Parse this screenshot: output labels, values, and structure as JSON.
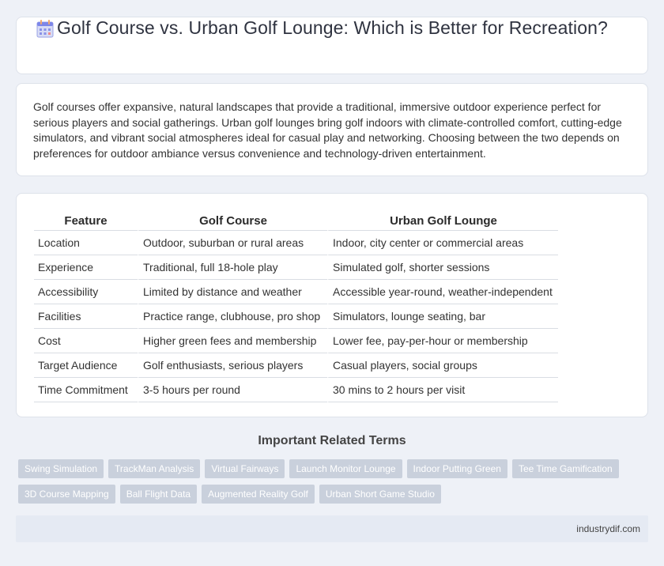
{
  "header": {
    "title": "Golf Course vs. Urban Golf Lounge: Which is Better for Recreation?",
    "icon": "calendar-icon"
  },
  "intro": {
    "text": "Golf courses offer expansive, natural landscapes that provide a traditional, immersive outdoor experience perfect for serious players and social gatherings. Urban golf lounges bring golf indoors with climate-controlled comfort, cutting-edge simulators, and vibrant social atmospheres ideal for casual play and networking. Choosing between the two depends on preferences for outdoor ambiance versus convenience and technology-driven entertainment."
  },
  "table": {
    "headers": [
      "Feature",
      "Golf Course",
      "Urban Golf Lounge"
    ],
    "rows": [
      [
        "Location",
        "Outdoor, suburban or rural areas",
        "Indoor, city center or commercial areas"
      ],
      [
        "Experience",
        "Traditional, full 18-hole play",
        "Simulated golf, shorter sessions"
      ],
      [
        "Accessibility",
        "Limited by distance and weather",
        "Accessible year-round, weather-independent"
      ],
      [
        "Facilities",
        "Practice range, clubhouse, pro shop",
        "Simulators, lounge seating, bar"
      ],
      [
        "Cost",
        "Higher green fees and membership",
        "Lower fee, pay-per-hour or membership"
      ],
      [
        "Target Audience",
        "Golf enthusiasts, serious players",
        "Casual players, social groups"
      ],
      [
        "Time Commitment",
        "3-5 hours per round",
        "30 mins to 2 hours per visit"
      ]
    ]
  },
  "related": {
    "heading": "Important Related Terms",
    "tags": [
      "Swing Simulation",
      "TrackMan Analysis",
      "Virtual Fairways",
      "Launch Monitor Lounge",
      "Indoor Putting Green",
      "Tee Time Gamification",
      "3D Course Mapping",
      "Ball Flight Data",
      "Augmented Reality Golf",
      "Urban Short Game Studio"
    ]
  },
  "footer": {
    "site": "industrydif.com"
  }
}
